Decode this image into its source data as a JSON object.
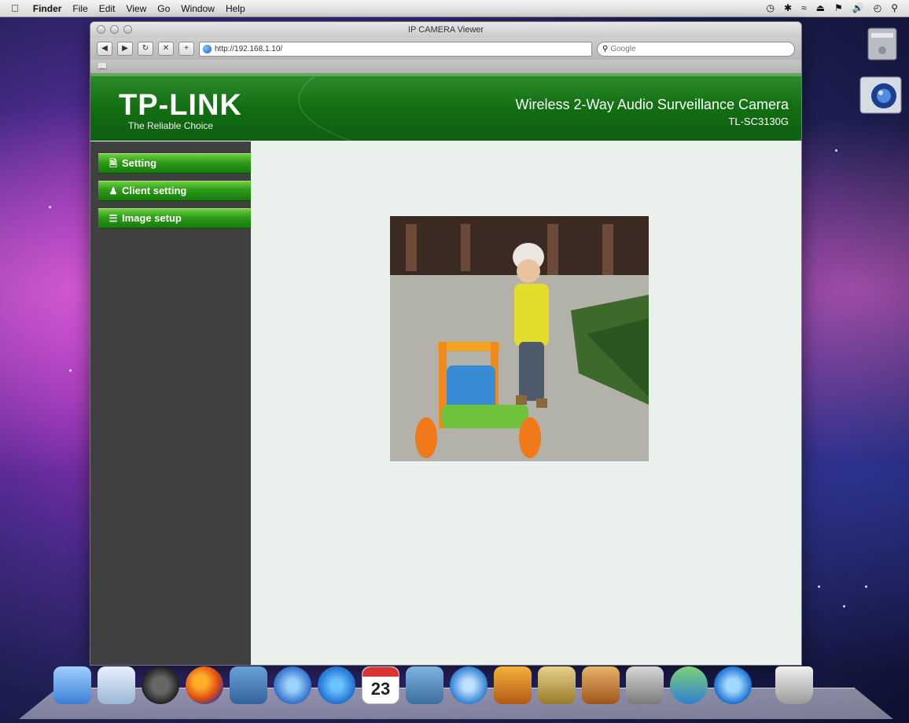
{
  "menubar": {
    "app": "Finder",
    "items": [
      "File",
      "Edit",
      "View",
      "Go",
      "Window",
      "Help"
    ]
  },
  "browser": {
    "window_title": "IP CAMERA Viewer",
    "url": "http://192.168.1.10/",
    "search_placeholder": "Google"
  },
  "page": {
    "brand": "TP-LINK",
    "tagline": "The Reliable Choice",
    "product_title": "Wireless 2-Way Audio Surveillance Camera",
    "model": "TL-SC3130G",
    "nav": [
      {
        "label": "Setting",
        "icon": "document-icon"
      },
      {
        "label": "Client setting",
        "icon": "users-icon"
      },
      {
        "label": "Image setup",
        "icon": "layout-icon"
      }
    ]
  },
  "dock": {
    "calendar_day": "23"
  },
  "colors": {
    "header_green": "#137013",
    "nav_green": "#2e9a1a",
    "sidebar": "#404040",
    "content_bg": "#eaf1ec"
  }
}
